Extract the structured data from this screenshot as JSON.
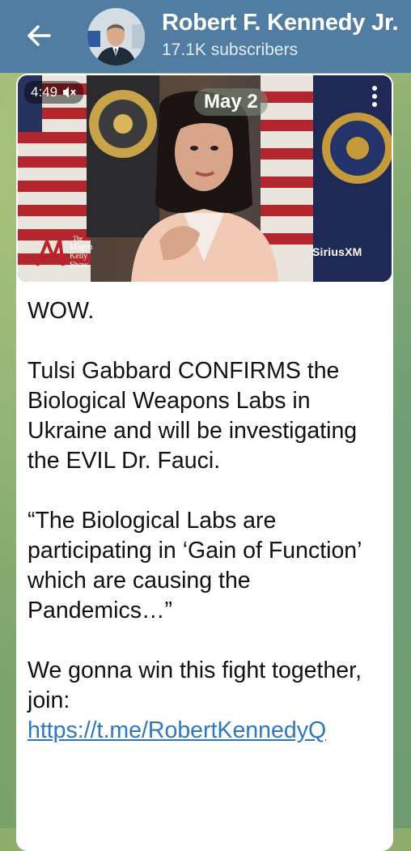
{
  "header": {
    "title": "Robert F. Kennedy Jr.",
    "subtitle": "17.1K subscribers",
    "back_icon": "arrow-left-icon",
    "header_color": "#517da2"
  },
  "video": {
    "duration": "4:49",
    "mute_icon": "speaker-muted-icon",
    "date": "May 2",
    "menu_icon": "more-vertical-icon",
    "watermark_left_line1": "The",
    "watermark_left_line2": "Megyn",
    "watermark_left_line3": "Kelly",
    "watermark_left_line4": "Show",
    "watermark_right": "SiriusXM"
  },
  "message": {
    "line1": "WOW.",
    "para2": "Tulsi Gabbard CONFIRMS the Biological Weapons Labs in Ukraine and will be investigating the EVIL Dr. Fauci.",
    "para3": "“The Biological Labs are participating in ‘Gain of Function’ which are causing the Pandemics…”",
    "para4": "We gonna win this fight together, join:",
    "link": "https://t.me/RobertKennedyQ",
    "link_color": "#2f78bd"
  }
}
